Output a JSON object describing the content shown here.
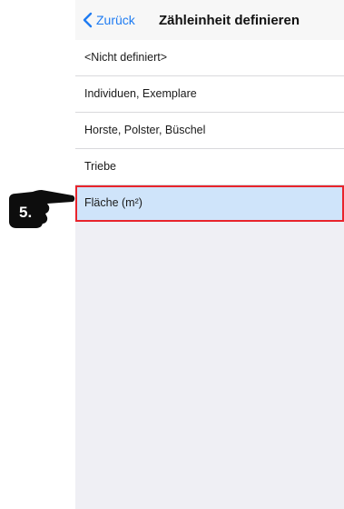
{
  "navbar": {
    "back_label": "Zurück",
    "title": "Zähleinheit definieren"
  },
  "list": {
    "items": [
      {
        "label": "<Nicht definiert>"
      },
      {
        "label": "Individuen, Exemplare"
      },
      {
        "label": "Horste, Polster, Büschel"
      },
      {
        "label": "Triebe"
      },
      {
        "label": "Fläche (m²)",
        "selected": true
      }
    ]
  },
  "annotation": {
    "step_label": "5."
  },
  "colors": {
    "accent": "#1f7cf2",
    "selection_bg": "#cfe4fa",
    "highlight_border": "#e8242c"
  }
}
